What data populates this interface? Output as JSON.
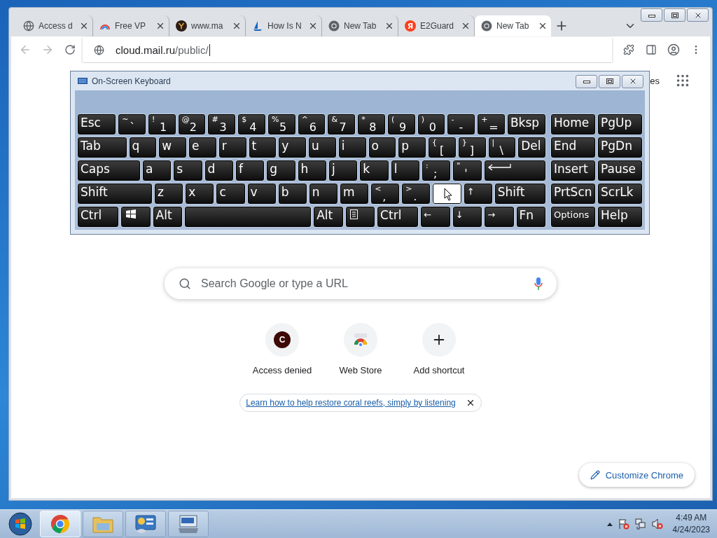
{
  "browser": {
    "tabs": [
      {
        "title": "Access d",
        "kind": "globe",
        "selected": false
      },
      {
        "title": "Free VP",
        "kind": "rainbow",
        "selected": false
      },
      {
        "title": "www.ma",
        "kind": "dark",
        "selected": false
      },
      {
        "title": "How Is N",
        "kind": "sail",
        "selected": false
      },
      {
        "title": "New Tab",
        "kind": "chrome",
        "selected": false
      },
      {
        "title": "E2Guard",
        "kind": "letter",
        "letter": "Я",
        "selected": false
      },
      {
        "title": "New Tab",
        "kind": "chrome",
        "selected": true
      }
    ],
    "address": {
      "host": "cloud.mail.ru",
      "path": "/public/"
    }
  },
  "page": {
    "header_link": "es",
    "search": {
      "placeholder": "Search Google or type a URL"
    },
    "shortcuts": [
      {
        "label": "Access denied",
        "kind": "letter",
        "letter": "C"
      },
      {
        "label": "Web Store",
        "kind": "webstore"
      },
      {
        "label": "Add shortcut",
        "kind": "add"
      }
    ],
    "promo_link": "Learn how to help restore coral reefs, simply by listening",
    "customize_button": "Customize Chrome"
  },
  "keyboard": {
    "title": "On-Screen Keyboard",
    "rows": [
      {
        "main": [
          {
            "label": "Esc",
            "kind": "medium",
            "highlighted": false
          },
          {
            "label": "`",
            "shift": "~",
            "kind": "key",
            "highlighted": false
          },
          {
            "label": "1",
            "shift": "!",
            "kind": "key",
            "highlighted": false
          },
          {
            "label": "2",
            "shift": "@",
            "kind": "key",
            "highlighted": false
          },
          {
            "label": "3",
            "shift": "#",
            "kind": "key",
            "highlighted": false
          },
          {
            "label": "4",
            "shift": "$",
            "kind": "key",
            "highlighted": false
          },
          {
            "label": "5",
            "shift": "%",
            "kind": "key",
            "highlighted": false
          },
          {
            "label": "6",
            "shift": "^",
            "kind": "key",
            "highlighted": false
          },
          {
            "label": "7",
            "shift": "&",
            "kind": "key",
            "highlighted": false
          },
          {
            "label": "8",
            "shift": "*",
            "kind": "key",
            "highlighted": false
          },
          {
            "label": "9",
            "shift": "(",
            "kind": "key",
            "highlighted": false
          },
          {
            "label": "0",
            "shift": ")",
            "kind": "key",
            "highlighted": false
          },
          {
            "label": "-",
            "shift": "-",
            "kind": "key",
            "highlighted": false
          },
          {
            "label": "=",
            "shift": "+",
            "kind": "key",
            "highlighted": false
          },
          {
            "label": "Bksp",
            "kind": "medium",
            "highlighted": false
          }
        ],
        "nav": [
          {
            "label": "Home",
            "kind": "key",
            "highlighted": false
          },
          {
            "label": "PgUp",
            "kind": "key",
            "highlighted": false
          }
        ]
      },
      {
        "main": [
          {
            "label": "Tab",
            "kind": "wide",
            "highlighted": false
          },
          {
            "label": "q",
            "kind": "key",
            "highlighted": false
          },
          {
            "label": "w",
            "kind": "key",
            "highlighted": false
          },
          {
            "label": "e",
            "kind": "key",
            "highlighted": false
          },
          {
            "label": "r",
            "kind": "key",
            "highlighted": false
          },
          {
            "label": "t",
            "kind": "key",
            "highlighted": false
          },
          {
            "label": "y",
            "kind": "key",
            "highlighted": false
          },
          {
            "label": "u",
            "kind": "key",
            "highlighted": false
          },
          {
            "label": "i",
            "kind": "key",
            "highlighted": false
          },
          {
            "label": "o",
            "kind": "key",
            "highlighted": false
          },
          {
            "label": "p",
            "kind": "key",
            "highlighted": false
          },
          {
            "label": "[",
            "shift": "{",
            "kind": "key",
            "highlighted": false
          },
          {
            "label": "]",
            "shift": "}",
            "kind": "key",
            "highlighted": false
          },
          {
            "label": "\\",
            "shift": "|",
            "kind": "key",
            "highlighted": false
          },
          {
            "label": "Del",
            "kind": "key",
            "highlighted": false
          }
        ],
        "nav": [
          {
            "label": "End",
            "kind": "key",
            "highlighted": false
          },
          {
            "label": "PgDn",
            "kind": "key",
            "highlighted": false
          }
        ]
      },
      {
        "main": [
          {
            "label": "Caps",
            "kind": "wider",
            "highlighted": false
          },
          {
            "label": "a",
            "kind": "key",
            "highlighted": false
          },
          {
            "label": "s",
            "kind": "key",
            "highlighted": false
          },
          {
            "label": "d",
            "kind": "key",
            "highlighted": false
          },
          {
            "label": "f",
            "kind": "key",
            "highlighted": false
          },
          {
            "label": "g",
            "kind": "key",
            "highlighted": false
          },
          {
            "label": "h",
            "kind": "key",
            "highlighted": false
          },
          {
            "label": "j",
            "kind": "key",
            "highlighted": false
          },
          {
            "label": "k",
            "kind": "key",
            "highlighted": false
          },
          {
            "label": "l",
            "kind": "key",
            "highlighted": false
          },
          {
            "label": ";",
            "shift": ":",
            "kind": "key",
            "highlighted": false
          },
          {
            "label": "'",
            "shift": "\"",
            "kind": "key",
            "highlighted": false
          },
          {
            "kind": "enter",
            "highlighted": false
          }
        ],
        "nav": [
          {
            "label": "Insert",
            "kind": "key",
            "highlighted": false
          },
          {
            "label": "Pause",
            "kind": "key",
            "highlighted": false
          }
        ]
      },
      {
        "main": [
          {
            "label": "Shift",
            "kind": "widest",
            "highlighted": false
          },
          {
            "label": "z",
            "kind": "key",
            "highlighted": false
          },
          {
            "label": "x",
            "kind": "key",
            "highlighted": false
          },
          {
            "label": "c",
            "kind": "key",
            "highlighted": false
          },
          {
            "label": "v",
            "kind": "key",
            "highlighted": false
          },
          {
            "label": "b",
            "kind": "key",
            "highlighted": false
          },
          {
            "label": "n",
            "kind": "key",
            "highlighted": false
          },
          {
            "label": "m",
            "kind": "key",
            "highlighted": false
          },
          {
            "label": ",",
            "shift": "<",
            "kind": "key",
            "highlighted": false
          },
          {
            "label": ".",
            "shift": ">",
            "kind": "key",
            "highlighted": false
          },
          {
            "kind": "blank",
            "highlighted": true
          },
          {
            "label": "↑",
            "kind": "small",
            "highlighted": false
          },
          {
            "label": "Shift",
            "kind": "wide",
            "highlighted": false
          }
        ],
        "nav": [
          {
            "label": "PrtScn",
            "kind": "key",
            "highlighted": false
          },
          {
            "label": "ScrLk",
            "kind": "key",
            "highlighted": false
          }
        ]
      },
      {
        "main": [
          {
            "label": "Ctrl",
            "kind": "medium",
            "highlighted": false
          },
          {
            "kind": "windows",
            "highlighted": false
          },
          {
            "label": "Alt",
            "kind": "key",
            "highlighted": false
          },
          {
            "kind": "space",
            "highlighted": false
          },
          {
            "label": "Alt",
            "kind": "key",
            "highlighted": false
          },
          {
            "kind": "menu",
            "highlighted": false
          },
          {
            "label": "Ctrl",
            "kind": "medium",
            "highlighted": false
          },
          {
            "label": "←",
            "kind": "small",
            "highlighted": false
          },
          {
            "label": "↓",
            "kind": "small",
            "highlighted": false
          },
          {
            "label": "→",
            "kind": "small",
            "highlighted": false
          },
          {
            "label": "Fn",
            "kind": "key",
            "highlighted": false
          }
        ],
        "nav": [
          {
            "label": "Options",
            "kind": "small",
            "highlighted": false
          },
          {
            "label": "Help",
            "kind": "key",
            "highlighted": false
          }
        ]
      }
    ]
  },
  "taskbar": {
    "items": [
      {
        "kind": "chrome",
        "selected": true
      },
      {
        "kind": "folder",
        "selected": false
      },
      {
        "kind": "panel",
        "selected": false
      },
      {
        "kind": "keyboard",
        "selected": false
      }
    ]
  },
  "clock": {
    "time": "4:49 AM",
    "date": "4/24/2023"
  }
}
